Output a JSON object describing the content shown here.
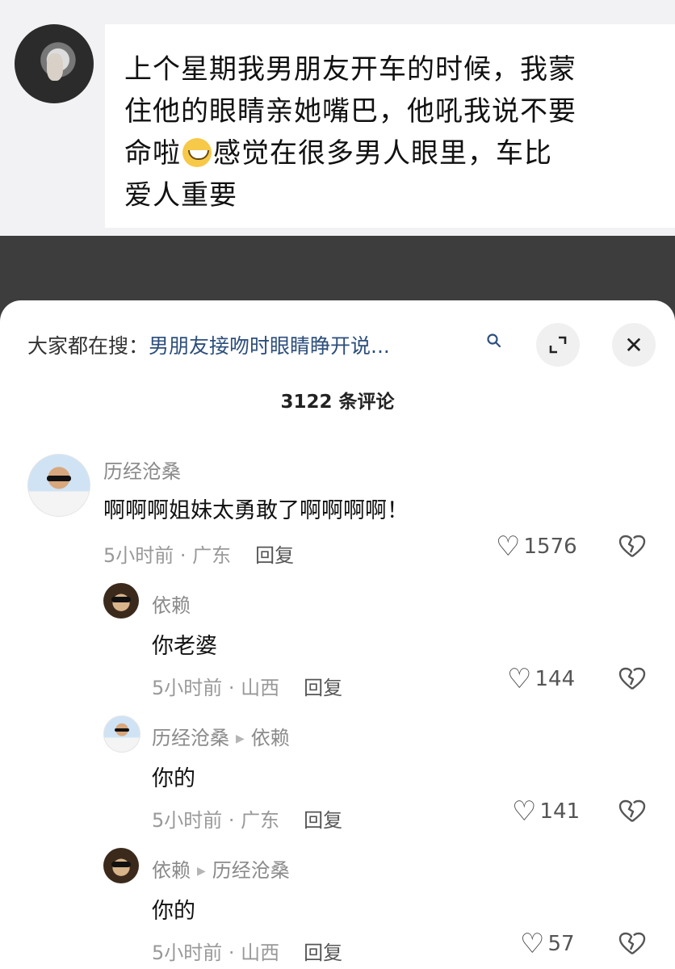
{
  "post": {
    "line1": "上个星期我男朋友开车的时候，我蒙",
    "line2": "住他的眼睛亲她嘴巴，他吼我说不要",
    "line3a": "命啦",
    "line3b": "感觉在很多男人眼里，车比",
    "line4": "爱人重要",
    "emoji_icon": "laughing-emoji"
  },
  "sheet": {
    "search_prefix": "大家都在搜：",
    "search_query": "男朋友接吻时眼睛睁开说...",
    "comment_count": "3122 条评论",
    "close_glyph": "✕",
    "expand_glyph": "⤢"
  },
  "comments": [
    {
      "user": "历经沧桑",
      "reply_to": "",
      "content": "啊啊啊姐妹太勇敢了啊啊啊啊！",
      "meta": "5小时前 · 广东",
      "reply_label": "回复",
      "likes": "1576"
    },
    {
      "user": "依赖",
      "reply_to": "",
      "content": "你老婆",
      "meta": "5小时前 · 山西",
      "reply_label": "回复",
      "likes": "144"
    },
    {
      "user": "历经沧桑",
      "reply_to": "依赖",
      "content": "你的",
      "meta": "5小时前 · 广东",
      "reply_label": "回复",
      "likes": "141"
    },
    {
      "user": "依赖",
      "reply_to": "历经沧桑",
      "content": "你的",
      "meta": "5小时前 · 山西",
      "reply_label": "回复",
      "likes": "57"
    }
  ]
}
